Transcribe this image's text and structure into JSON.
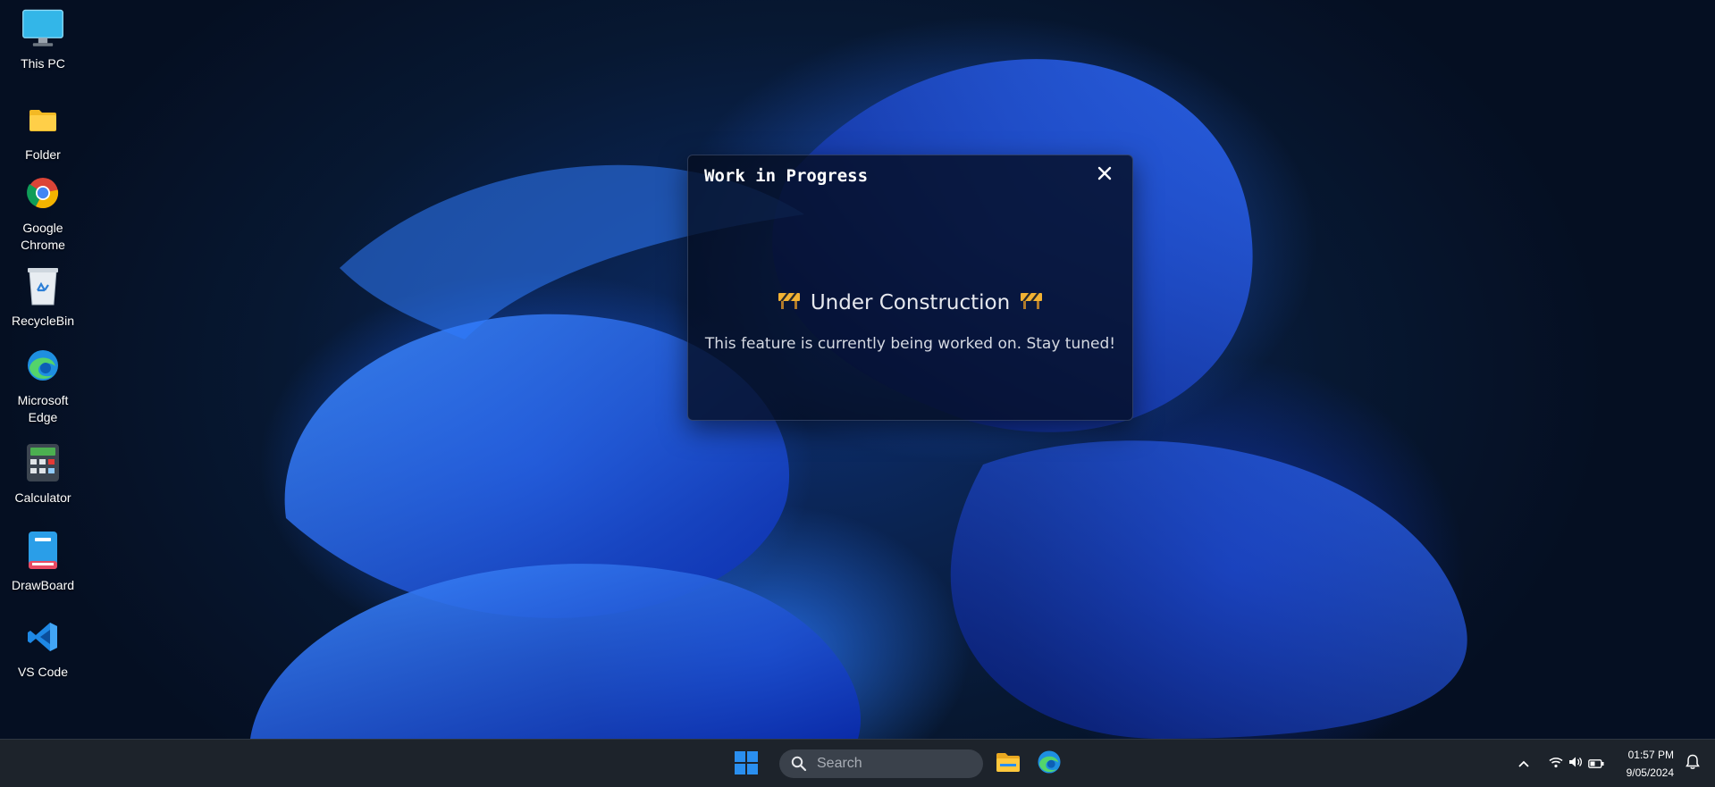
{
  "desktop": {
    "icons": [
      {
        "label": "This PC",
        "icon": "monitor-icon"
      },
      {
        "label": "Folder",
        "icon": "folder-icon"
      },
      {
        "label": "Google Chrome",
        "icon": "chrome-icon"
      },
      {
        "label": "RecycleBin",
        "icon": "recycle-bin-icon"
      },
      {
        "label": "Microsoft Edge",
        "icon": "edge-icon"
      },
      {
        "label": "Calculator",
        "icon": "calculator-icon"
      },
      {
        "label": "DrawBoard",
        "icon": "drawboard-icon"
      },
      {
        "label": "VS Code",
        "icon": "vscode-icon"
      }
    ]
  },
  "modal": {
    "title": "Work in Progress",
    "heading": "Under Construction",
    "heading_icon": "construction-barrier-icon",
    "message": "This feature is currently being worked on. Stay tuned!",
    "close_icon": "close-icon"
  },
  "taskbar": {
    "search_placeholder": "Search",
    "apps": [
      "file-explorer-icon",
      "edge-icon"
    ],
    "tray": {
      "time": "01:57 PM",
      "date": "9/05/2024",
      "icons": [
        "chevron-up-icon",
        "wifi-icon",
        "volume-icon",
        "battery-icon",
        "notification-bell-icon"
      ]
    }
  },
  "colors": {
    "accent": "#2a8ff0",
    "taskbar_bg": "#1d232b",
    "modal_bg": "#040c1e"
  }
}
